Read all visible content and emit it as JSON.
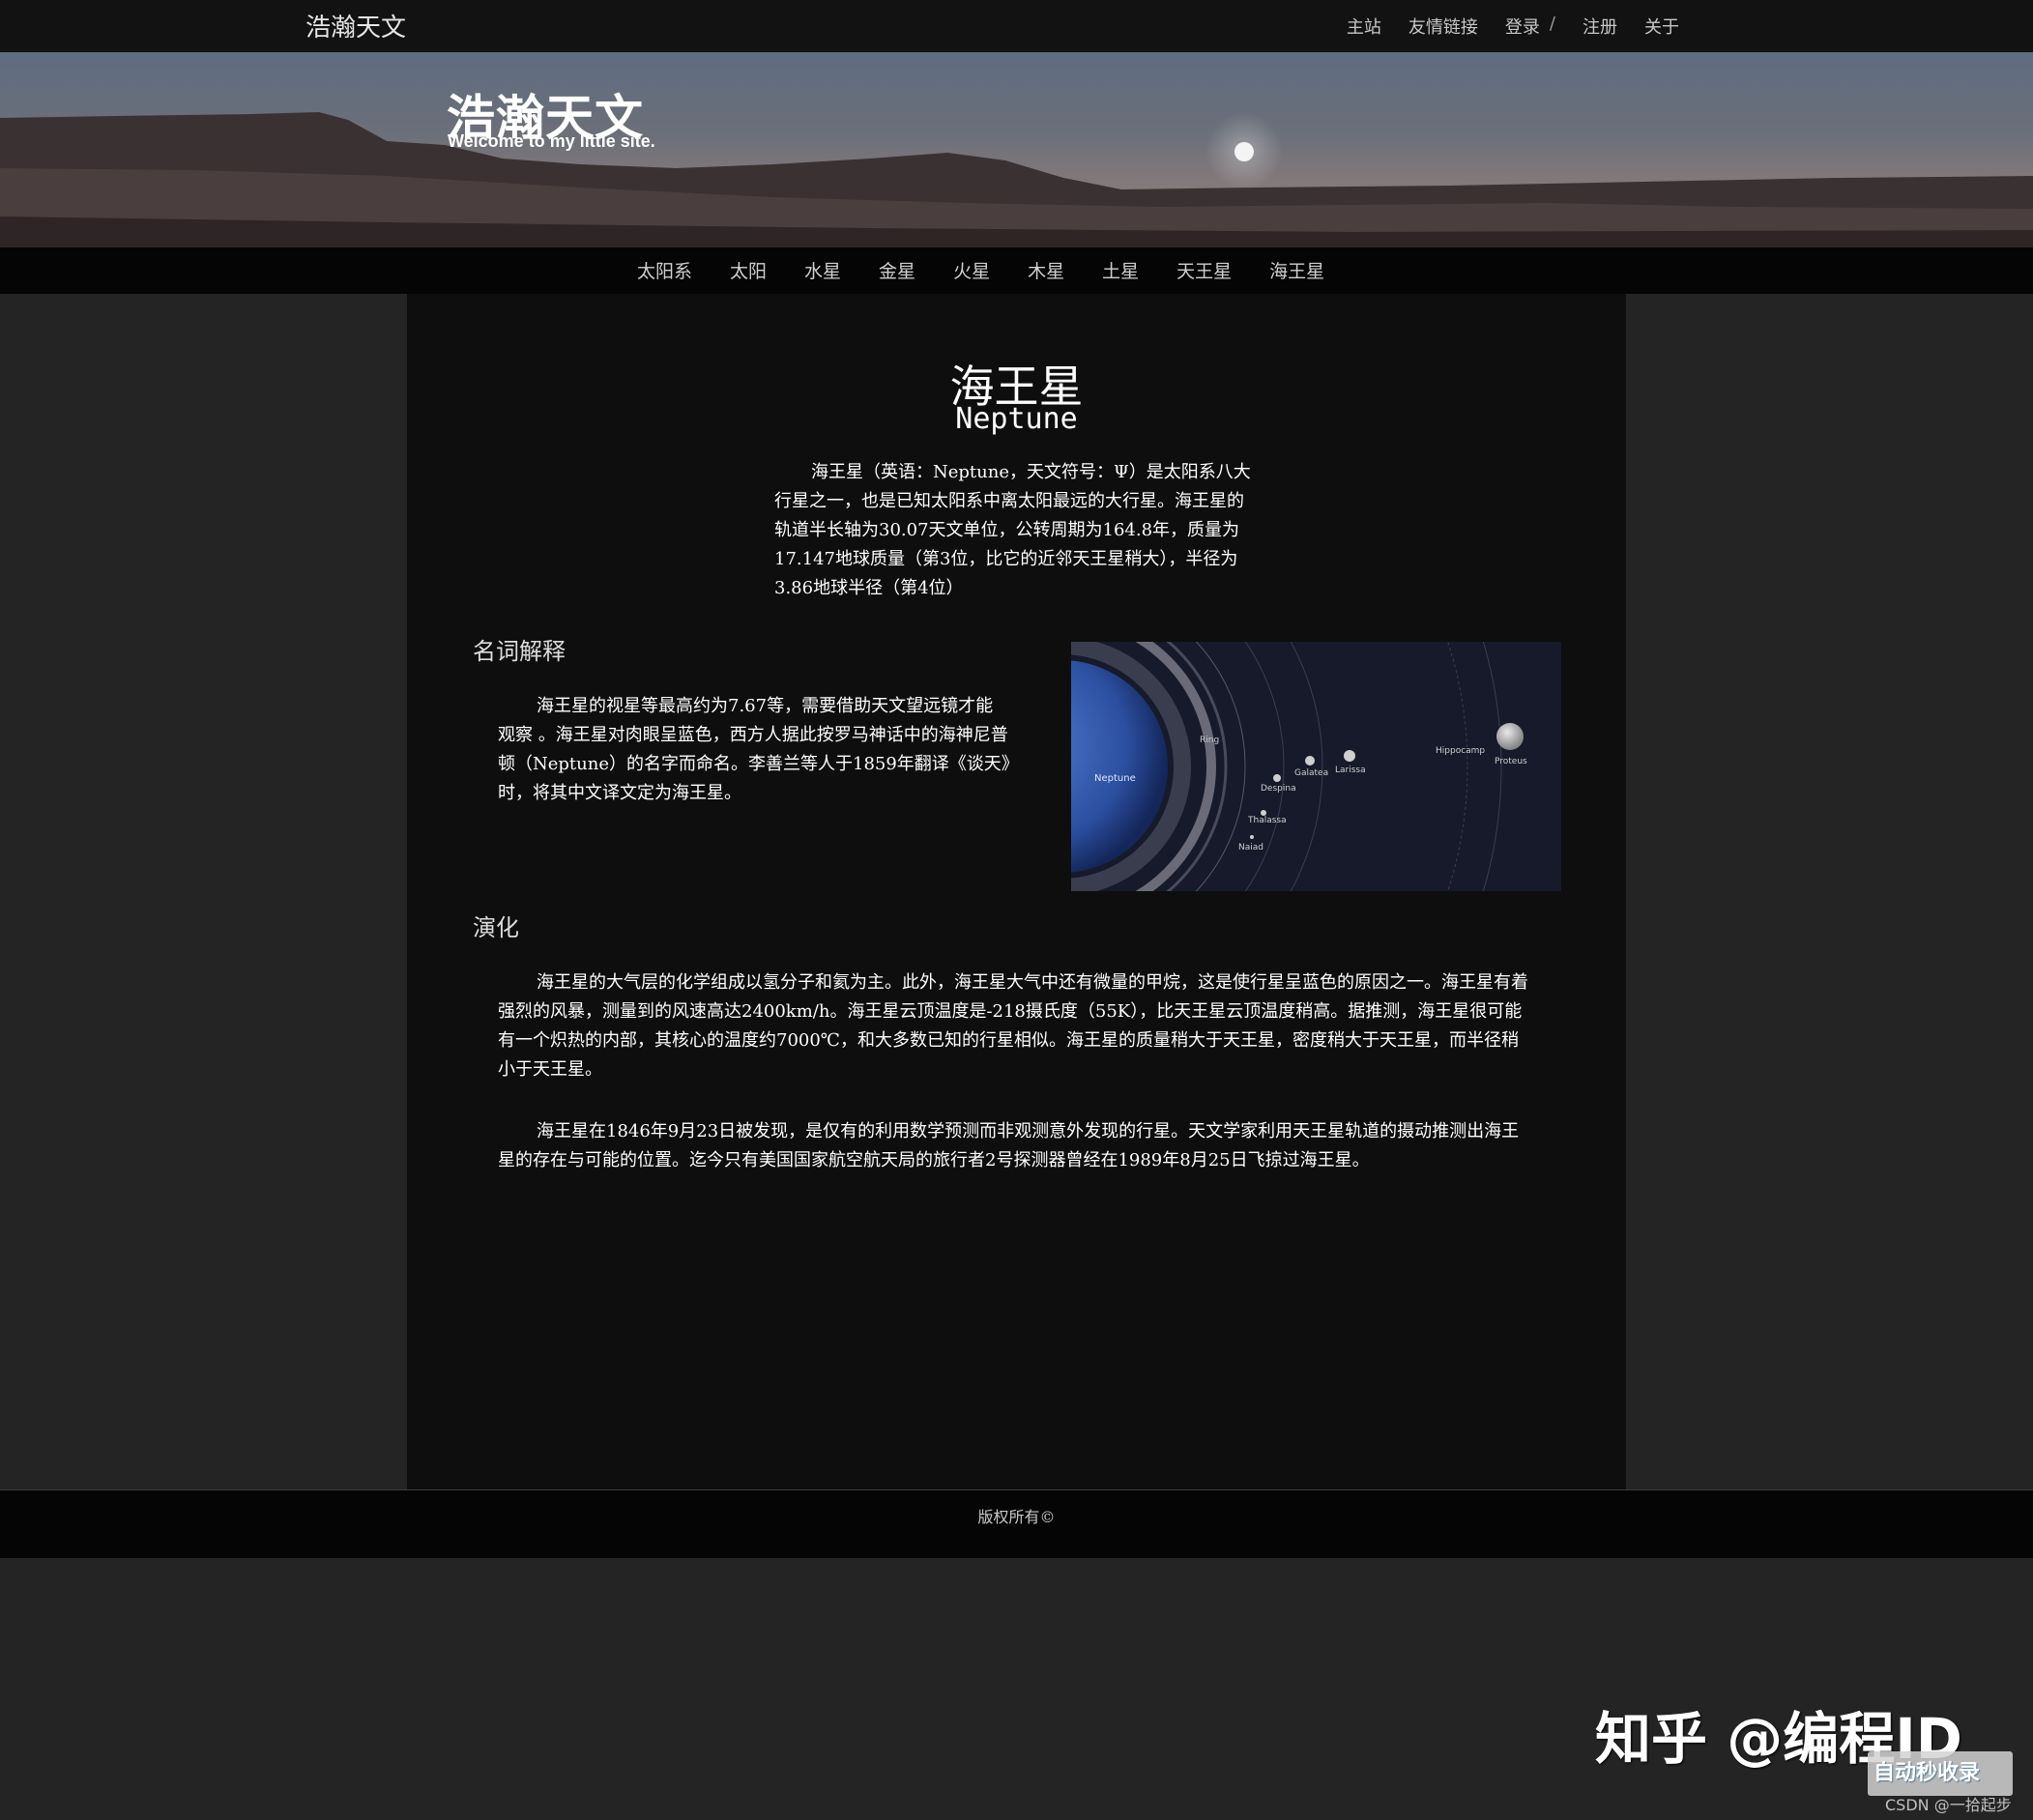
{
  "topbar": {
    "site_name": "浩瀚天文",
    "nav": [
      "主站",
      "友情链接",
      "登录",
      "/",
      "注册",
      "关于"
    ]
  },
  "banner": {
    "title": "浩瀚天文",
    "subtitle": "Welcome to my little site."
  },
  "planet_nav": [
    "太阳系",
    "太阳",
    "水星",
    "金星",
    "火星",
    "木星",
    "土星",
    "天王星",
    "海王星"
  ],
  "article": {
    "title_cn": "海王星",
    "title_en": "Neptune",
    "intro": "海王星（英语：Neptune，天文符号：Ψ）是太阳系八大行星之一，也是已知太阳系中离太阳最远的大行星。海王星的轨道半长轴为30.07天文单位，公转周期为164.8年，质量为17.147地球质量（第3位，比它的近邻天王星稍大），半径为3.86地球半径（第4位）",
    "section1_title": "名词解释",
    "section1_text": "海王星的视星等最高约为7.67等，需要借助天文望远镜才能观察 。海王星对肉眼呈蓝色，西方人据此按罗马神话中的海神尼普顿（Neptune）的名字而命名。李善兰等人于1859年翻译《谈天》时，将其中文译文定为海王星。",
    "section2_title": "演化",
    "section2_p1": "海王星的大气层的化学组成以氢分子和氦为主。此外，海王星大气中还有微量的甲烷，这是使行星呈蓝色的原因之一。海王星有着强烈的风暴，测量到的风速高达2400km/h。海王星云顶温度是-218摄氏度（55K），比天王星云顶温度稍高。据推测，海王星很可能有一个炽热的内部，其核心的温度约7000℃，和大多数已知的行星相似。海王星的质量稍大于天王星，密度稍大于天王星，而半径稍小于天王星。",
    "section2_p2": "海王星在1846年9月23日被发现，是仅有的利用数学预测而非观测意外发现的行星。天文学家利用天王星轨道的摄动推测出海王星的存在与可能的位置。迄今只有美国国家航空航天局的旅行者2号探测器曾经在1989年8月25日飞掠过海王星。"
  },
  "diagram_labels": {
    "neptune": "Neptune",
    "ring": "Ring",
    "despina": "Despina",
    "galatea": "Galatea",
    "larissa": "Larissa",
    "thalassa": "Thalassa",
    "naiad": "Naiad",
    "hippocamp": "Hippocamp",
    "proteus": "Proteus"
  },
  "footer": {
    "copyright": "版权所有©"
  },
  "watermark": {
    "main": "知乎 @编程ID",
    "badge": "自动秒收录",
    "csdn": "CSDN @一拾起步"
  },
  "colors": {
    "page_bg": "#242424",
    "content_bg": "#0e0e0e",
    "topbar_bg": "#121212",
    "nav_bg": "#050505"
  }
}
